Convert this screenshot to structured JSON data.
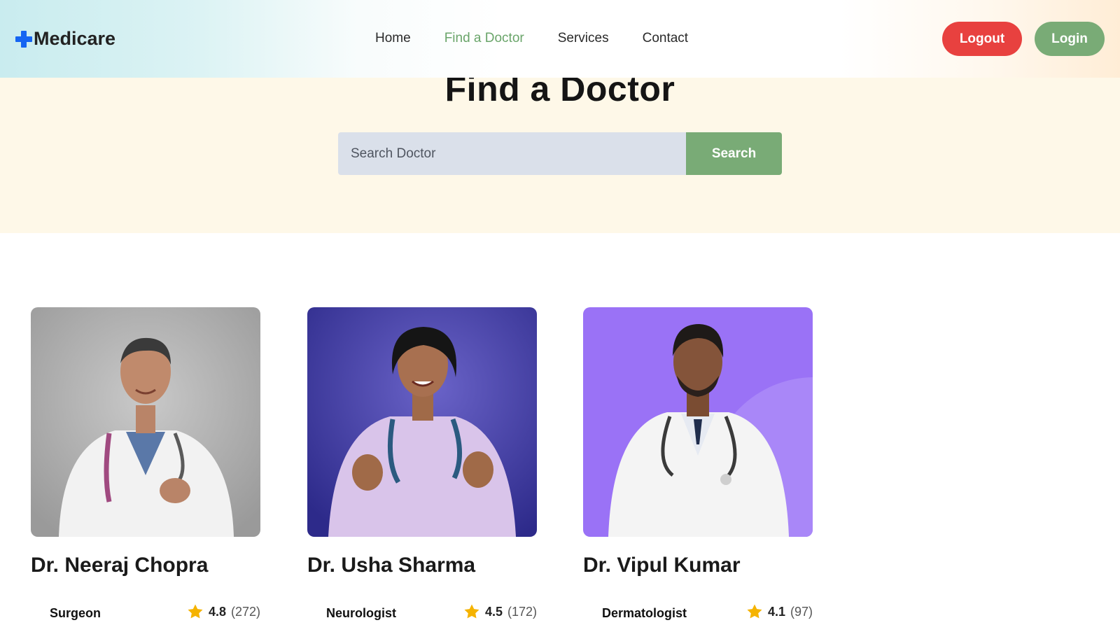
{
  "header": {
    "logo_text": "Medicare",
    "nav": [
      "Home",
      "Find a Doctor",
      "Services",
      "Contact"
    ],
    "active_nav": "Find a Doctor",
    "logout_label": "Logout",
    "login_label": "Login"
  },
  "hero": {
    "title": "Find a Doctor",
    "search_placeholder": "Search Doctor",
    "search_value": "",
    "search_button": "Search"
  },
  "doctors": [
    {
      "name": "Dr. Neeraj Chopra",
      "specialty": "Surgeon",
      "rating": "4.8",
      "reviews": "(272)"
    },
    {
      "name": "Dr. Usha Sharma",
      "specialty": "Neurologist",
      "rating": "4.5",
      "reviews": "(172)"
    },
    {
      "name": "Dr. Vipul Kumar",
      "specialty": "Dermatologist",
      "rating": "4.1",
      "reviews": "(97)"
    }
  ],
  "colors": {
    "accent_green": "#79ab76",
    "logout_red": "#e8413f",
    "logo_blue": "#1565f2",
    "star_yellow": "#f5b300"
  },
  "icons": {
    "logo": "plus-icon",
    "rating": "star-icon"
  }
}
